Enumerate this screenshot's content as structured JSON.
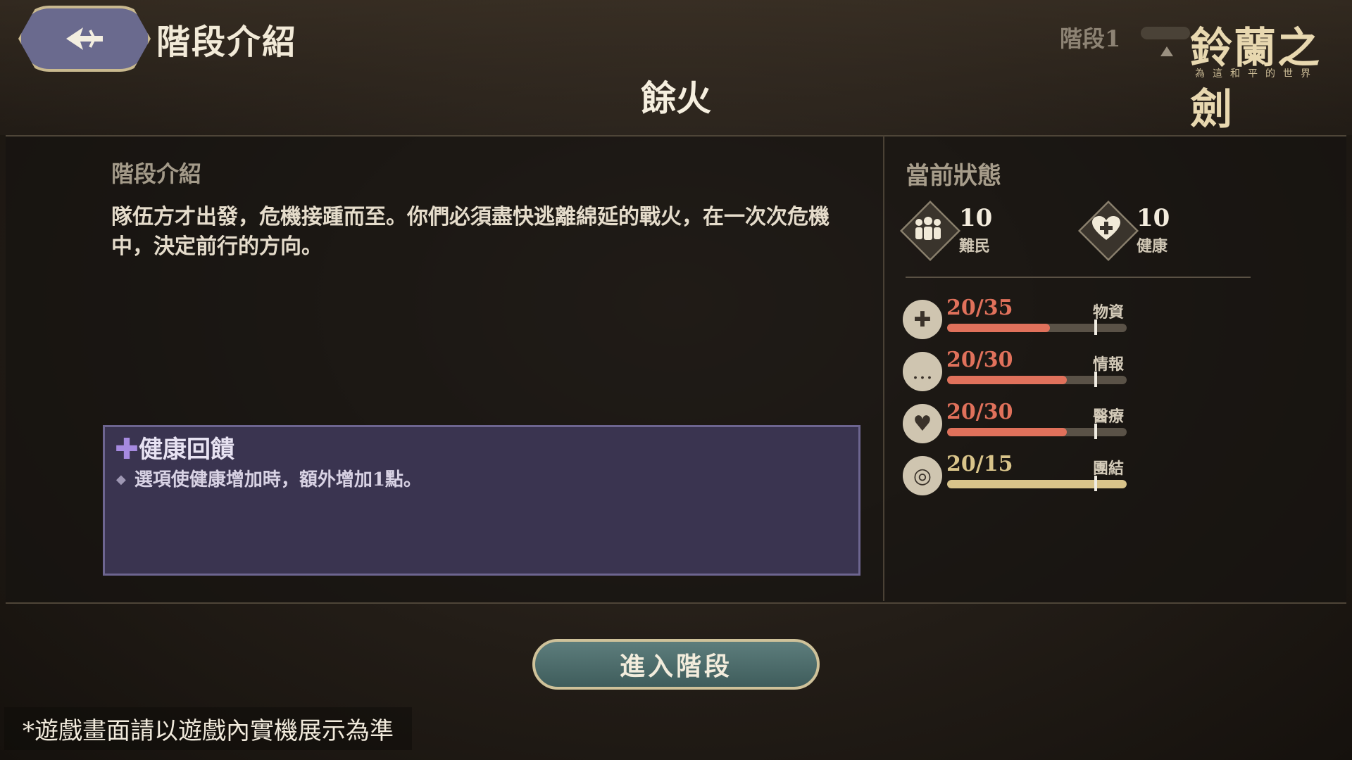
{
  "header": {
    "title": "階段介紹",
    "stage_indicator": "階段1",
    "logo_title": "鈴蘭之劍",
    "logo_subtitle": "為這和平的世界"
  },
  "stage_name": "餘火",
  "intro": {
    "label": "階段介紹",
    "description": "隊伍方才出發，危機接踵而至。你們必須盡快逃離綿延的戰火，在一次次危機中，決定前行的方向。"
  },
  "effect": {
    "title": "健康回饋",
    "body": "選項使健康增加時，額外增加1點。"
  },
  "status": {
    "label": "當前狀態",
    "stats": [
      {
        "value": "10",
        "name": "難民",
        "icon": "refugees-icon"
      },
      {
        "value": "10",
        "name": "健康",
        "icon": "health-heart-icon"
      }
    ],
    "resources": [
      {
        "value": "20/35",
        "name": "物資",
        "current": 20,
        "max": 35,
        "color": "#e0715b",
        "icon": "supplies-bag-icon"
      },
      {
        "value": "20/30",
        "name": "情報",
        "current": 20,
        "max": 30,
        "color": "#e0715b",
        "icon": "intel-speech-icon"
      },
      {
        "value": "20/30",
        "name": "醫療",
        "current": 20,
        "max": 30,
        "color": "#e0715b",
        "icon": "medical-heart-icon"
      },
      {
        "value": "20/15",
        "name": "團結",
        "current": 20,
        "max": 15,
        "color": "#d9c48a",
        "icon": "unity-swirl-icon"
      }
    ]
  },
  "enter_button": "進入階段",
  "disclaimer": "*遊戲畫面請以遊戲內實機展示為準"
}
